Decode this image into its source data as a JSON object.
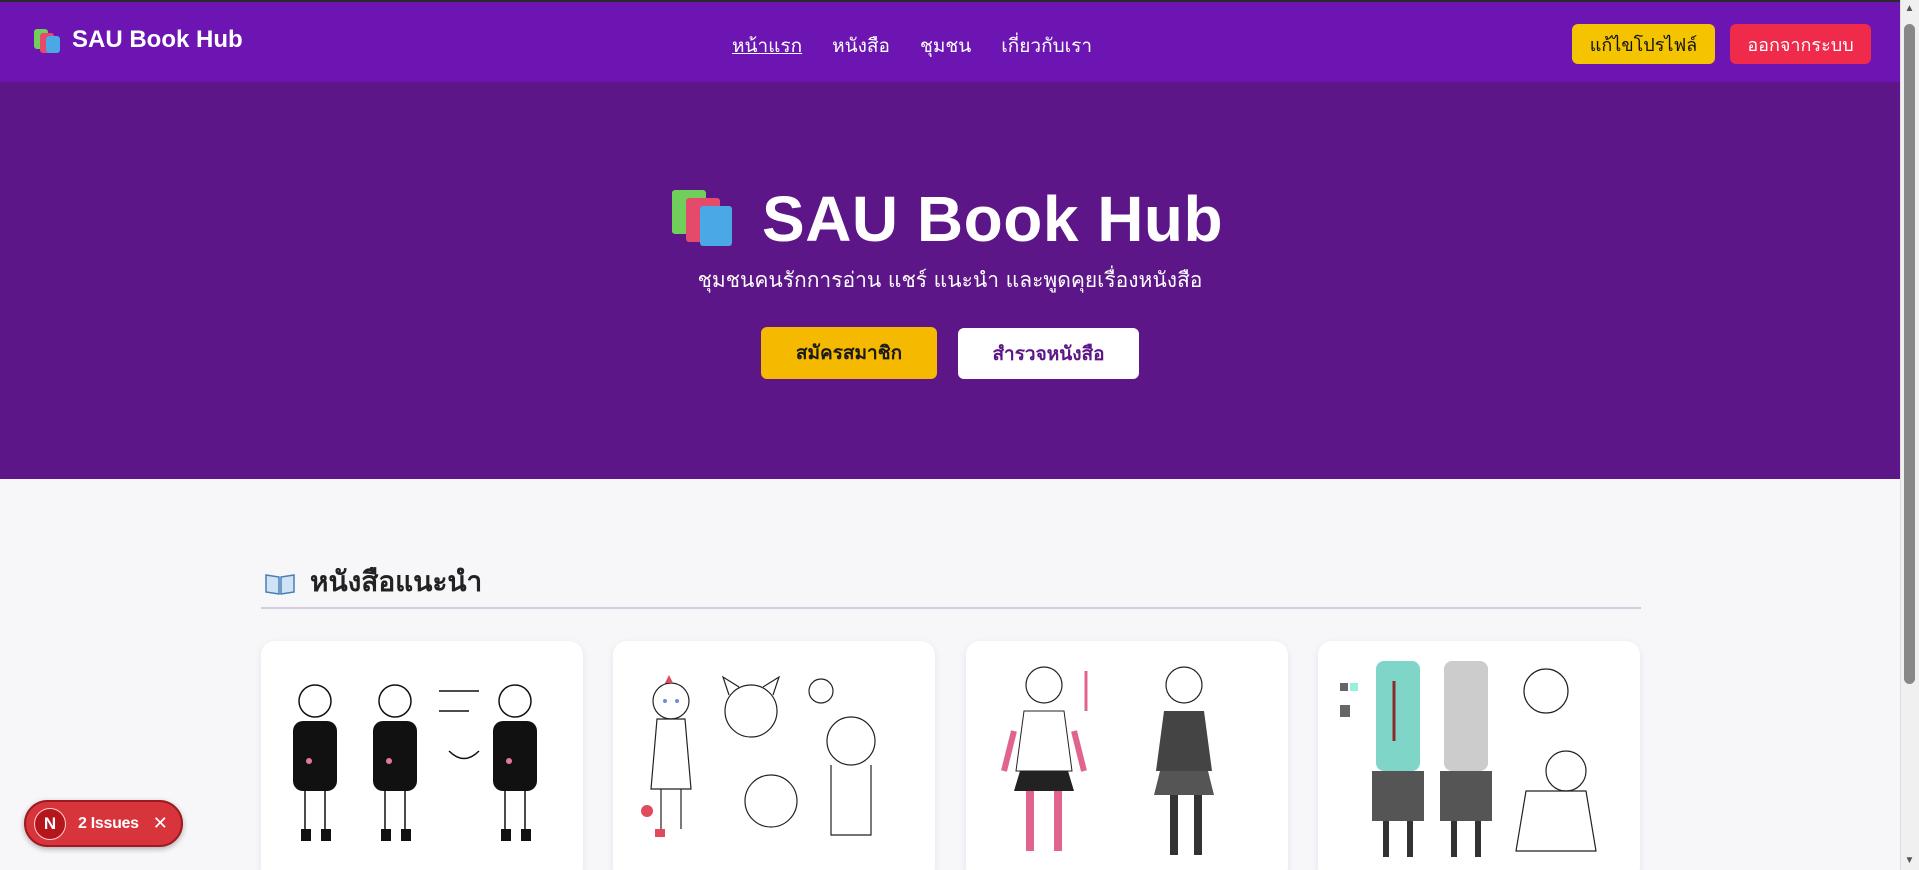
{
  "nav": {
    "brand": "SAU Book Hub",
    "links": [
      "หน้าแรก",
      "หนังสือ",
      "ชุมชน",
      "เกี่ยวกับเรา"
    ],
    "edit_profile": "แก้ไขโปรไฟล์",
    "logout": "ออกจากระบบ"
  },
  "hero": {
    "title": "SAU Book Hub",
    "subtitle": "ชุมชนคนรักการอ่าน แชร์ แนะนำ และพูดคุยเรื่องหนังสือ",
    "signup": "สมัครสมาชิก",
    "explore": "สำรวจหนังสือ"
  },
  "section": {
    "title": "หนังสือแนะนำ"
  },
  "cards": [
    {
      "image": "character-sheet-black-outfits"
    },
    {
      "image": "character-sheet-cat-sketches"
    },
    {
      "image": "character-sheet-pink-outfits"
    },
    {
      "image": "character-sheet-teal-outfits"
    }
  ],
  "issues": {
    "avatar": "N",
    "label": "2 Issues"
  },
  "colors": {
    "nav": "#6c15b3",
    "hero": "#5d1688",
    "accent_yellow": "#f5c400",
    "logout_red": "#ef2a4b"
  }
}
